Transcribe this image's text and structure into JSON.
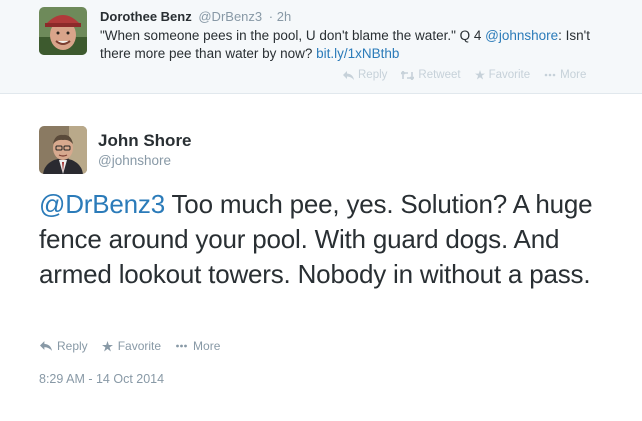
{
  "colors": {
    "link": "#2b7bb9",
    "text": "#292f33",
    "muted": "#8899a6",
    "reply_bg": "#f5f8fa"
  },
  "reply_tweet": {
    "author_name": "Dorothee Benz",
    "author_handle": "@DrBenz3",
    "separator": "·",
    "time": "2h",
    "text_before": "\"When someone pees in the pool, U don't blame the water.\" Q 4 ",
    "mention": "@johnshore",
    "text_after": ": Isn't there more pee than water by now? ",
    "link": "bit.ly/1xNBthb",
    "actions": [
      {
        "label": "Reply",
        "icon": "reply-icon"
      },
      {
        "label": "Retweet",
        "icon": "retweet-icon"
      },
      {
        "label": "Favorite",
        "icon": "star-icon"
      },
      {
        "label": "More",
        "icon": "more-dots-icon"
      }
    ]
  },
  "main_tweet": {
    "author_name": "John Shore",
    "author_handle": "@johnshore",
    "mention": "@DrBenz3",
    "text": " Too much pee, yes. Solution? A huge fence around your pool. With guard dogs. And armed lookout towers. Nobody in without a pass.",
    "actions": [
      {
        "label": "Reply",
        "icon": "reply-icon"
      },
      {
        "label": "Favorite",
        "icon": "star-icon"
      },
      {
        "label": "More",
        "icon": "more-dots-icon"
      }
    ],
    "timestamp": "8:29 AM - 14 Oct 2014"
  }
}
